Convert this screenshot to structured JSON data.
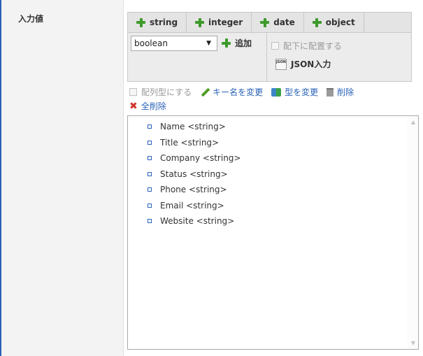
{
  "field": {
    "label": "入力値"
  },
  "tabs": [
    {
      "label": "string",
      "icon": "plus-icon"
    },
    {
      "label": "integer",
      "icon": "plus-icon"
    },
    {
      "label": "date",
      "icon": "plus-icon"
    },
    {
      "label": "object",
      "icon": "plus-icon"
    }
  ],
  "controls": {
    "type_select_value": "boolean",
    "add_label": "追加",
    "place_under_label": "配下に配置する",
    "json_input_label": "JSON入力",
    "json_icon_text": "JSON"
  },
  "toolbar": {
    "array_label": "配列型にする",
    "rename_key_label": "キー名を変更",
    "change_type_label": "型を変更",
    "delete_label": "削除",
    "delete_all_label": "全削除"
  },
  "tree": {
    "items": [
      {
        "name": "Name",
        "type": "<string>"
      },
      {
        "name": "Title",
        "type": "<string>"
      },
      {
        "name": "Company",
        "type": "<string>"
      },
      {
        "name": "Status",
        "type": "<string>"
      },
      {
        "name": "Phone",
        "type": "<string>"
      },
      {
        "name": "Email",
        "type": "<string>"
      },
      {
        "name": "Website",
        "type": "<string>"
      }
    ]
  },
  "colors": {
    "accent": "#2a62b8",
    "plus_green": "#3d9a2a",
    "delete_red": "#d0352c"
  }
}
